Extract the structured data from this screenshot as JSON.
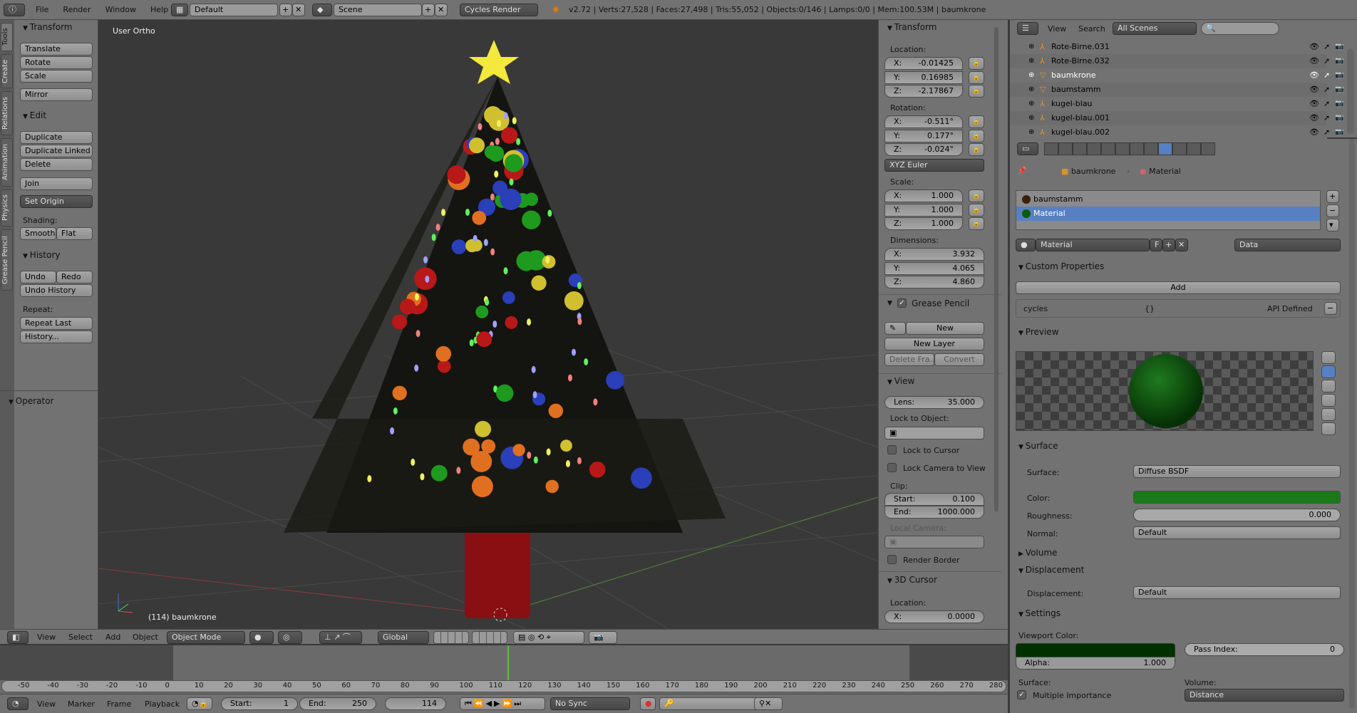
{
  "topbar": {
    "menus": [
      "File",
      "Render",
      "Window",
      "Help"
    ],
    "layout": "Default",
    "scene": "Scene",
    "engine": "Cycles Render",
    "stats": "v2.72 | Verts:27,528 | Faces:27,498 | Tris:55,052 | Objects:0/146 | Lamps:0/0 | Mem:100.53M | baumkrone"
  },
  "tool_tabs": [
    "Tools",
    "Create",
    "Relations",
    "Animation",
    "Physics",
    "Grease Pencil"
  ],
  "toolshelf": {
    "transform": {
      "title": "Transform",
      "buttons": [
        "Translate",
        "Rotate",
        "Scale",
        "Mirror"
      ]
    },
    "edit": {
      "title": "Edit",
      "buttons": [
        "Duplicate",
        "Duplicate Linked",
        "Delete",
        "Join"
      ],
      "set_origin": "Set Origin",
      "shading_label": "Shading:",
      "smooth": "Smooth",
      "flat": "Flat"
    },
    "history": {
      "title": "History",
      "undo": "Undo",
      "redo": "Redo",
      "undo_history": "Undo History",
      "repeat_label": "Repeat:",
      "repeat_last": "Repeat Last",
      "history": "History..."
    },
    "operator": "Operator"
  },
  "viewport": {
    "view_name": "User Ortho",
    "object_label": "(114) baumkrone"
  },
  "npanel": {
    "transform": "Transform",
    "location_label": "Location:",
    "location": [
      [
        "X:",
        "-0.01425"
      ],
      [
        "Y:",
        "0.16985"
      ],
      [
        "Z:",
        "-2.17867"
      ]
    ],
    "rotation_label": "Rotation:",
    "rotation": [
      [
        "X:",
        "-0.511°"
      ],
      [
        "Y:",
        "0.177°"
      ],
      [
        "Z:",
        "-0.024°"
      ]
    ],
    "rotation_mode": "XYZ Euler",
    "scale_label": "Scale:",
    "scale": [
      [
        "X:",
        "1.000"
      ],
      [
        "Y:",
        "1.000"
      ],
      [
        "Z:",
        "1.000"
      ]
    ],
    "dimensions_label": "Dimensions:",
    "dimensions": [
      [
        "X:",
        "3.932"
      ],
      [
        "Y:",
        "4.065"
      ],
      [
        "Z:",
        "4.860"
      ]
    ],
    "grease_pencil": "Grease Pencil",
    "gp_new": "New",
    "gp_new_layer": "New Layer",
    "gp_delete_frame": "Delete Fra...",
    "gp_convert": "Convert",
    "view": "View",
    "lens_label": "Lens:",
    "lens": "35.000",
    "lock_object": "Lock to Object:",
    "lock_cursor": "Lock to Cursor",
    "lock_camera": "Lock Camera to View",
    "clip": "Clip:",
    "clip_start_label": "Start:",
    "clip_start": "0.100",
    "clip_end_label": "End:",
    "clip_end": "1000.000",
    "local_camera": "Local Camera:",
    "render_border": "Render Border",
    "cursor": "3D Cursor",
    "cursor_location": "Location:",
    "cursor_x_label": "X:",
    "cursor_x": "0.0000"
  },
  "outliner": {
    "view": "View",
    "search": "Search",
    "scenes": "All Scenes",
    "search_placeholder": "",
    "items": [
      {
        "name": "Rote-Birne.031",
        "type": "empty"
      },
      {
        "name": "Rote-Birne.032",
        "type": "empty"
      },
      {
        "name": "baumkrone",
        "type": "mesh",
        "active": true
      },
      {
        "name": "baumstamm",
        "type": "mesh"
      },
      {
        "name": "kugel-blau",
        "type": "empty"
      },
      {
        "name": "kugel-blau.001",
        "type": "empty"
      },
      {
        "name": "kugel-blau.002",
        "type": "empty"
      }
    ]
  },
  "properties": {
    "breadcrumb": [
      "baumkrone",
      "Material"
    ],
    "slots": [
      {
        "name": "baumstamm",
        "color": "#3a1f0e"
      },
      {
        "name": "Material",
        "color": "#0c5a0c",
        "selected": true
      }
    ],
    "material_name": "Material",
    "fake_user": "F",
    "link": "Data",
    "custom_props": "Custom Properties",
    "add": "Add",
    "prop_name": "cycles",
    "prop_value": "{}",
    "prop_api": "API Defined",
    "preview": "Preview",
    "surface": "Surface",
    "surface_label": "Surface:",
    "surface_value": "Diffuse BSDF",
    "color_label": "Color:",
    "color": "#1a7a1a",
    "roughness_label": "Roughness:",
    "roughness": "0.000",
    "normal_label": "Normal:",
    "normal": "Default",
    "volume": "Volume",
    "displacement": "Displacement",
    "displacement_label": "Displacement:",
    "displacement_value": "Default",
    "settings": "Settings",
    "viewport_color_label": "Viewport Color:",
    "viewport_color": "#003000",
    "alpha_label": "Alpha:",
    "alpha": "1.000",
    "pass_index_label": "Pass Index:",
    "pass_index": "0",
    "surface_sub": "Surface:",
    "multiple_importance": "Multiple Importance",
    "volume_sub": "Volume:",
    "volume_value": "Distance"
  },
  "header3d": {
    "menus": [
      "View",
      "Select",
      "Add",
      "Object"
    ],
    "mode": "Object Mode",
    "orientation": "Global"
  },
  "timeline": {
    "ticks": [
      "-50",
      "-40",
      "-30",
      "-20",
      "-10",
      "0",
      "10",
      "20",
      "30",
      "40",
      "50",
      "60",
      "70",
      "80",
      "90",
      "100",
      "110",
      "120",
      "130",
      "140",
      "150",
      "160",
      "170",
      "180",
      "190",
      "200",
      "210",
      "220",
      "230",
      "240",
      "250",
      "260",
      "270",
      "280"
    ],
    "menus": [
      "View",
      "Marker",
      "Frame",
      "Playback"
    ],
    "start_label": "Start:",
    "start": "1",
    "end_label": "End:",
    "end": "250",
    "current": "114",
    "sync": "No Sync"
  }
}
